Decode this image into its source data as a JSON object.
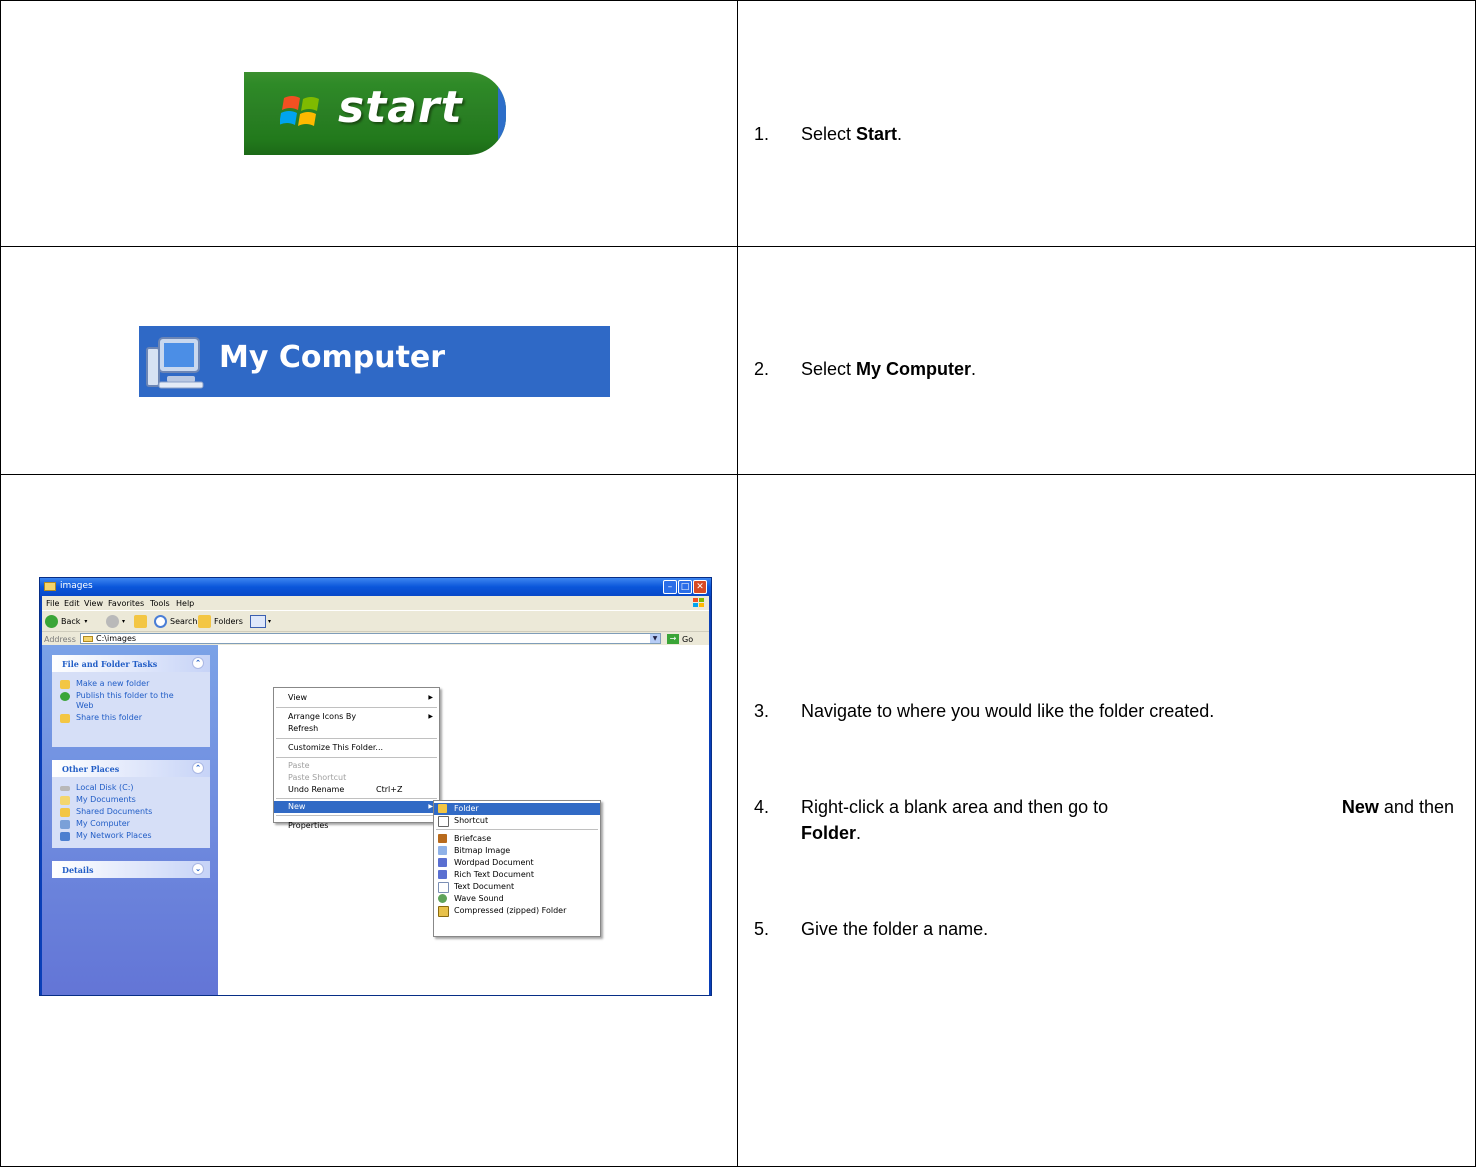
{
  "steps": [
    {
      "num": "1.",
      "pre": "Select ",
      "bold": "Start",
      "post": "."
    },
    {
      "num": "2.",
      "pre": "Select ",
      "bold": "My Computer",
      "post": "."
    },
    {
      "num": "3.",
      "text": "Navigate to where you would like the folder created."
    },
    {
      "num": "4.",
      "pre": "Right-click a blank area and then go to ",
      "bold": "New",
      "mid": " and then",
      "bold2": "Folder",
      "post": "."
    },
    {
      "num": "5.",
      "text": "Give the folder a name."
    }
  ],
  "start_button": {
    "label": "start"
  },
  "my_computer": {
    "label": "My Computer"
  },
  "explorer": {
    "title": "images",
    "menu": [
      "File",
      "Edit",
      "View",
      "Favorites",
      "Tools",
      "Help"
    ],
    "toolbar": {
      "back": "Back",
      "search": "Search",
      "folders": "Folders"
    },
    "address": {
      "label": "Address",
      "value": "C:\\images",
      "go": "Go"
    },
    "tasks_panel": {
      "title": "File and Folder Tasks",
      "items": [
        "Make a new folder",
        "Publish this folder to the",
        "Web",
        "Share this folder"
      ]
    },
    "places_panel": {
      "title": "Other Places",
      "items": [
        "Local Disk (C:)",
        "My Documents",
        "Shared Documents",
        "My Computer",
        "My Network Places"
      ]
    },
    "details_panel": {
      "title": "Details"
    },
    "context_menu": {
      "view": "View",
      "arrange": "Arrange Icons By",
      "refresh": "Refresh",
      "customize": "Customize This Folder...",
      "paste": "Paste",
      "paste_shortcut": "Paste Shortcut",
      "undo": "Undo Rename",
      "undo_shortcut": "Ctrl+Z",
      "new": "New",
      "properties": "Properties"
    },
    "new_submenu": [
      "Folder",
      "Shortcut",
      "Briefcase",
      "Bitmap Image",
      "Wordpad Document",
      "Rich Text Document",
      "Text Document",
      "Wave Sound",
      "Compressed (zipped) Folder"
    ]
  },
  "colors": {
    "start_green": "#2e8a27",
    "xp_blue": "#2f69c6",
    "highlight": "#316ac5"
  }
}
